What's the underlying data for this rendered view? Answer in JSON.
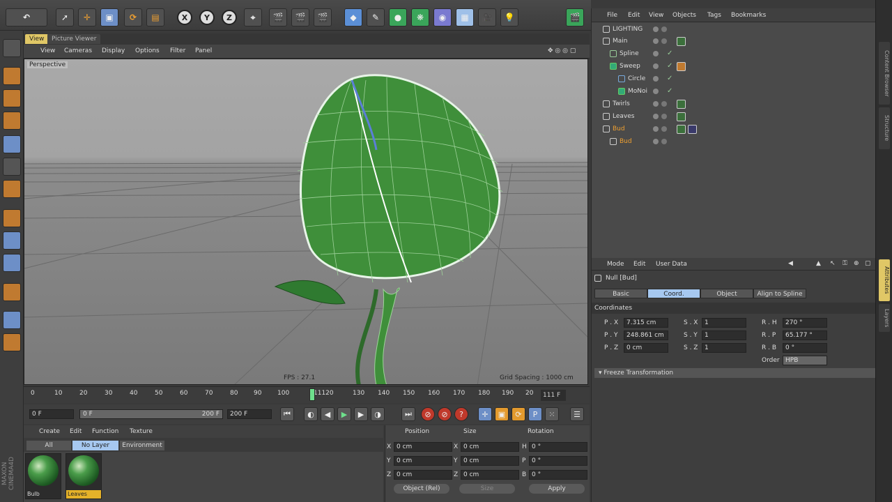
{
  "viewport": {
    "tabs": [
      "View",
      "Picture Viewer"
    ],
    "menu": [
      "View",
      "Cameras",
      "Display",
      "Options",
      "Filter",
      "Panel"
    ],
    "camera_label": "Perspective",
    "fps_label": "FPS : 27.1",
    "grid_spacing": "Grid Spacing : 1000 cm"
  },
  "toolbar": {
    "axis_x": "X",
    "axis_y": "Y",
    "axis_z": "Z",
    "undo_icon": "undo-icon"
  },
  "timeline": {
    "ticks": [
      "0",
      "10",
      "20",
      "30",
      "40",
      "50",
      "60",
      "70",
      "80",
      "90",
      "100",
      "11120",
      "130",
      "140",
      "150",
      "160",
      "170",
      "180",
      "190",
      "20"
    ],
    "current_frame_box": "111 F"
  },
  "transport": {
    "start_field": "0 F",
    "range_start": "0 F",
    "range_end": "200 F",
    "end_field": "200 F"
  },
  "materials": {
    "menu": [
      "Create",
      "Edit",
      "Function",
      "Texture"
    ],
    "tabs": [
      "All",
      "No Layer",
      "Environment"
    ],
    "items": [
      {
        "label": "Bulb",
        "selected": false
      },
      {
        "label": "Leaves",
        "selected": true
      }
    ]
  },
  "coords": {
    "headers": [
      "Position",
      "Size",
      "Rotation"
    ],
    "rows": [
      {
        "axis": "X",
        "pos": "0 cm",
        "size_axis": "X",
        "size": "0 cm",
        "rot_axis": "H",
        "rot": "0 °"
      },
      {
        "axis": "Y",
        "pos": "0 cm",
        "size_axis": "Y",
        "size": "0 cm",
        "rot_axis": "P",
        "rot": "0 °"
      },
      {
        "axis": "Z",
        "pos": "0 cm",
        "size_axis": "Z",
        "size": "0 cm",
        "rot_axis": "B",
        "rot": "0 °"
      }
    ],
    "mode_select": "Object (Rel)",
    "size_select": "Size",
    "apply_label": "Apply"
  },
  "objects": {
    "menu": [
      "File",
      "Edit",
      "View",
      "Objects",
      "Tags",
      "Bookmarks"
    ],
    "items": [
      {
        "name": "LIGHTING",
        "indent": 0,
        "selected": false
      },
      {
        "name": "Main",
        "indent": 0,
        "selected": false
      },
      {
        "name": "Spline",
        "indent": 1,
        "selected": false
      },
      {
        "name": "Sweep",
        "indent": 1,
        "selected": false
      },
      {
        "name": "Circle",
        "indent": 2,
        "selected": false
      },
      {
        "name": "MoNoi",
        "indent": 2,
        "selected": false
      },
      {
        "name": "Twirls",
        "indent": 0,
        "selected": false
      },
      {
        "name": "Leaves",
        "indent": 0,
        "selected": false
      },
      {
        "name": "Bud",
        "indent": 0,
        "selected": true
      },
      {
        "name": "Bud",
        "indent": 1,
        "selected": true
      }
    ]
  },
  "attributes": {
    "menu": [
      "Mode",
      "Edit",
      "User Data"
    ],
    "title": "Null [Bud]",
    "tabs": [
      "Basic",
      "Coord.",
      "Object",
      "Align to Spline"
    ],
    "section": "Coordinates",
    "rows": [
      {
        "p_label": "P . X",
        "p_val": "7.315 cm",
        "s_label": "S . X",
        "s_val": "1",
        "r_label": "R . H",
        "r_val": "270 °"
      },
      {
        "p_label": "P . Y",
        "p_val": "248.861 cm",
        "s_label": "S . Y",
        "s_val": "1",
        "r_label": "R . P",
        "r_val": "65.177 °"
      },
      {
        "p_label": "P . Z",
        "p_val": "0 cm",
        "s_label": "S . Z",
        "s_val": "1",
        "r_label": "R . B",
        "r_val": "0 °"
      }
    ],
    "order_label": "Order",
    "order_value": "HPB",
    "freeze_label": "▾ Freeze Transformation"
  },
  "brand": "MAXON CINEMA4D",
  "right_tabs": [
    "Content Browser",
    "Structure",
    "Attributes",
    "Layers"
  ],
  "colors": {
    "accent_blue": "#6d8fc7",
    "selection_orange": "#f0a030",
    "timeline_playhead": "#6ee08c",
    "mesh_green": "#3f8f3a"
  }
}
